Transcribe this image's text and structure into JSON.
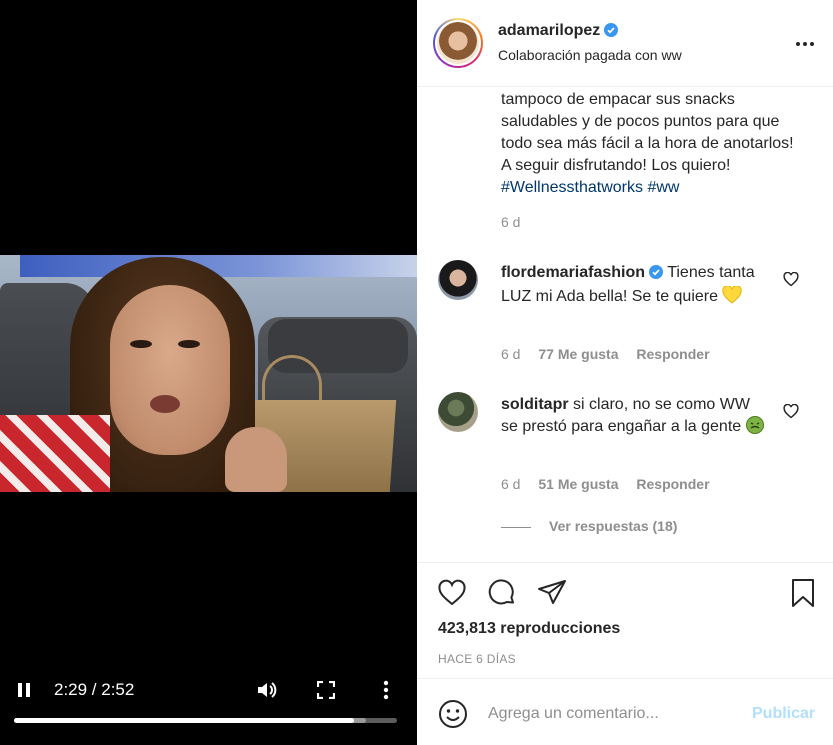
{
  "video": {
    "time_display": "2:29 / 2:52",
    "played_fraction": 0.889,
    "buffered_fraction": 0.92
  },
  "header": {
    "username": "adamarilopez",
    "subline": "Colaboración pagada con ww"
  },
  "caption": {
    "text": "tampoco de empacar sus snacks saludables y de pocos puntos para que todo sea más fácil a la hora de anotarlos! A seguir disfrutando! Los quiero! ",
    "hashtag_1": "#Wellnessthatworks",
    "hashtag_2": "#ww",
    "age": "6 d"
  },
  "comments": [
    {
      "username": "flordemariafashion",
      "text": "Tienes tanta LUZ mi Ada bella! Se te quiere",
      "age": "6 d",
      "likes": "77 Me gusta",
      "reply": "Responder",
      "emoji_icon": "yellow-heart-icon"
    },
    {
      "username": "solditapr",
      "text": "si claro, no se como WW se prestó para engañar a la gente",
      "age": "6 d",
      "likes": "51 Me gusta",
      "reply": "Responder",
      "emoji_icon": "nauseated-face-icon"
    }
  ],
  "view_replies": "Ver respuestas (18)",
  "stats": {
    "views": "423,813 reproducciones",
    "ago": "HACE 6 DÍAS"
  },
  "add_comment": {
    "placeholder": "Agrega un comentario...",
    "publish": "Publicar"
  },
  "colors": {
    "hashtag": "#00376b",
    "verified": "#3897f0",
    "publish_disabled": "#b2dffc"
  }
}
